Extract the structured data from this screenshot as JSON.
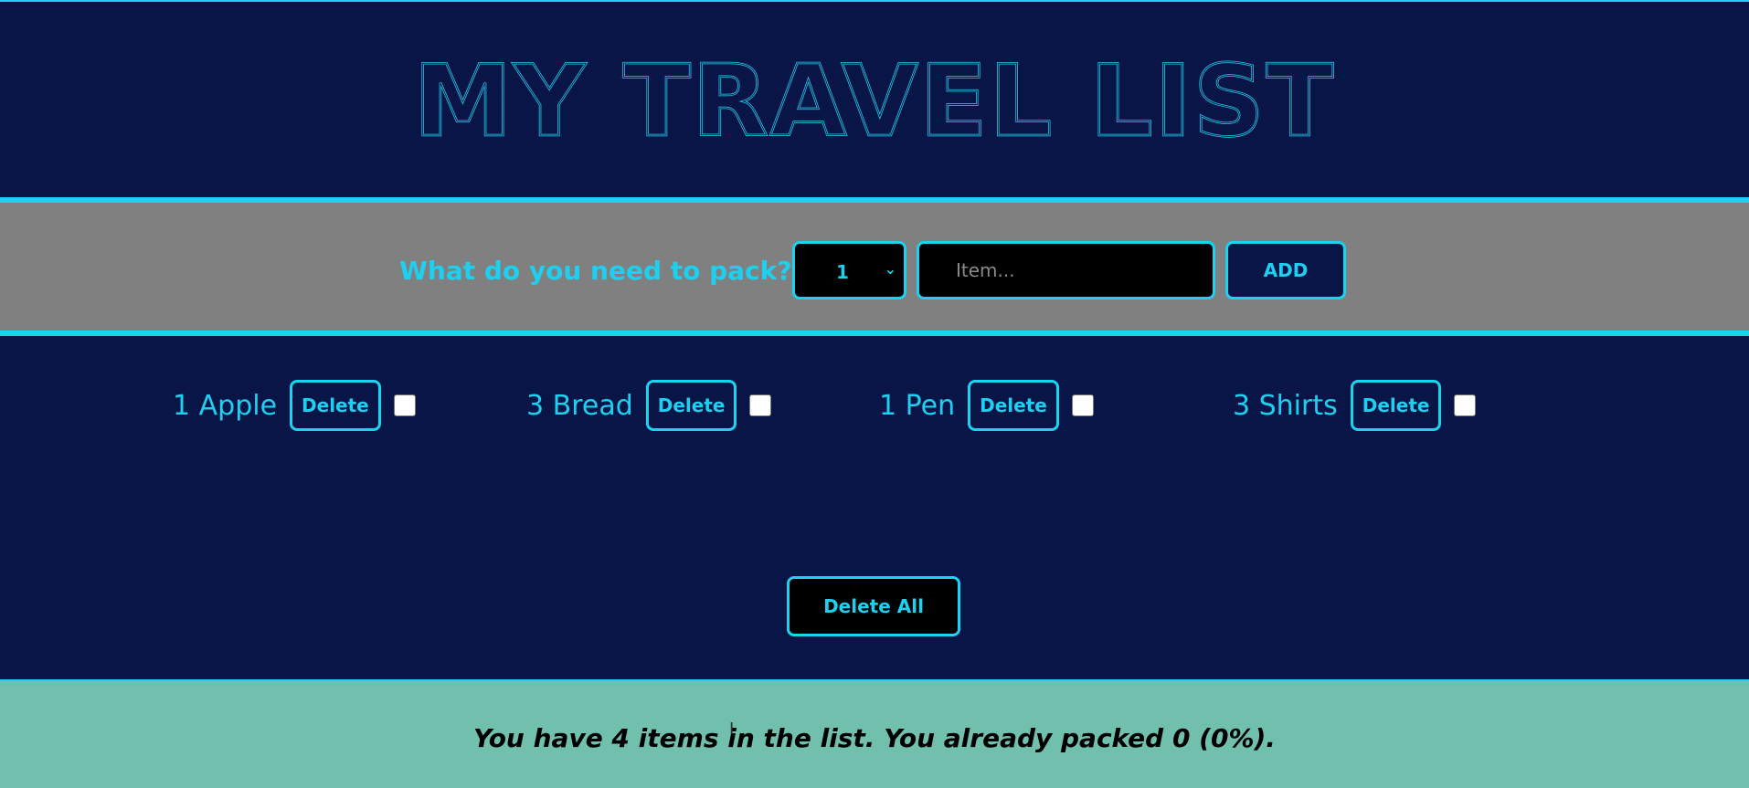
{
  "header": {
    "title": "MY TRAVEL LIST"
  },
  "form": {
    "prompt": "What do you need to pack?",
    "quantity_selected": "1",
    "item_placeholder": "Item...",
    "add_label": "ADD"
  },
  "items": [
    {
      "quantity": "1",
      "description": "Apple",
      "text": "1 Apple",
      "delete_label": "Delete",
      "packed": false
    },
    {
      "quantity": "3",
      "description": "Bread",
      "text": "3 Bread",
      "delete_label": "Delete",
      "packed": false
    },
    {
      "quantity": "1",
      "description": "Pen",
      "text": "1 Pen",
      "delete_label": "Delete",
      "packed": false
    },
    {
      "quantity": "3",
      "description": "Shirts",
      "text": "3 Shirts",
      "delete_label": "Delete",
      "packed": false
    }
  ],
  "actions": {
    "delete_all_label": "Delete All"
  },
  "stats": {
    "text": "You have 4 items in the list. You already packed 0 (0%)."
  },
  "colors": {
    "background": "#0a1547",
    "accent": "#19d3f0",
    "form_bar": "#808080",
    "footer": "#71bfad"
  }
}
